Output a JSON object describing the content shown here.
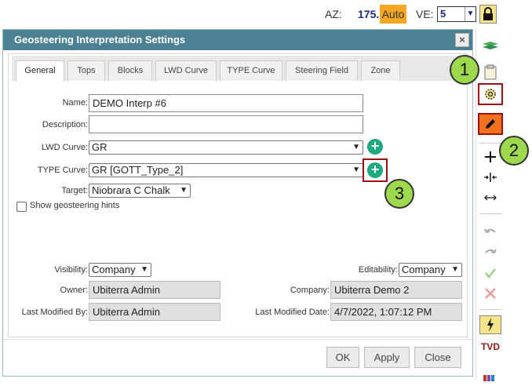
{
  "topbar": {
    "az_label": "AZ:",
    "az_value": "175.103°",
    "auto_label": "Auto",
    "ve_label": "VE:",
    "ve_value": "5"
  },
  "dialog": {
    "title": "Geosteering Interpretation Settings",
    "close_label": "×",
    "tabs": [
      {
        "label": "General"
      },
      {
        "label": "Tops"
      },
      {
        "label": "Blocks"
      },
      {
        "label": "LWD Curve"
      },
      {
        "label": "TYPE Curve"
      },
      {
        "label": "Steering Field"
      },
      {
        "label": "Zone"
      }
    ],
    "fields": {
      "name": {
        "label": "Name:",
        "value": "DEMO Interp #6"
      },
      "description": {
        "label": "Description:",
        "value": ""
      },
      "lwd_curve": {
        "label": "LWD Curve:",
        "value": "GR"
      },
      "type_curve": {
        "label": "TYPE Curve:",
        "value": "GR [GOTT_Type_2]"
      },
      "target": {
        "label": "Target:",
        "value": "Niobrara C Chalk"
      },
      "hints": {
        "label": "Show geosteering hints"
      },
      "visibility": {
        "label": "Visibility:",
        "value": "Company"
      },
      "editability": {
        "label": "Editability:",
        "value": "Company"
      },
      "owner": {
        "label": "Owner:",
        "value": "Ubiterra Admin"
      },
      "company": {
        "label": "Company:",
        "value": "Ubiterra Demo 2"
      },
      "last_modified_by": {
        "label": "Last Modified By:",
        "value": "Ubiterra Admin"
      },
      "last_modified_date": {
        "label": "Last Modified Date:",
        "value": "4/7/2022, 1:07:12 PM"
      }
    },
    "buttons": {
      "ok": "OK",
      "apply": "Apply",
      "close": "Close"
    }
  },
  "toolbar": {
    "tvd_label": "TVD",
    "icons": [
      "layers-icon",
      "clipboard-icon",
      "settings-icon",
      "pencil-icon",
      "plus-icon",
      "split-vertical-icon",
      "split-horizontal-icon",
      "undo-icon",
      "redo-icon",
      "check-icon",
      "cancel-icon",
      "bolt-icon",
      "tvd-icon",
      "palette-icon"
    ]
  },
  "callouts": [
    "1",
    "2",
    "3"
  ],
  "colors": {
    "accent": "#4b8193",
    "auto": "#f5a623",
    "callout": "#9ed84c",
    "highlight": "#a01010",
    "add": "#1fa981"
  }
}
